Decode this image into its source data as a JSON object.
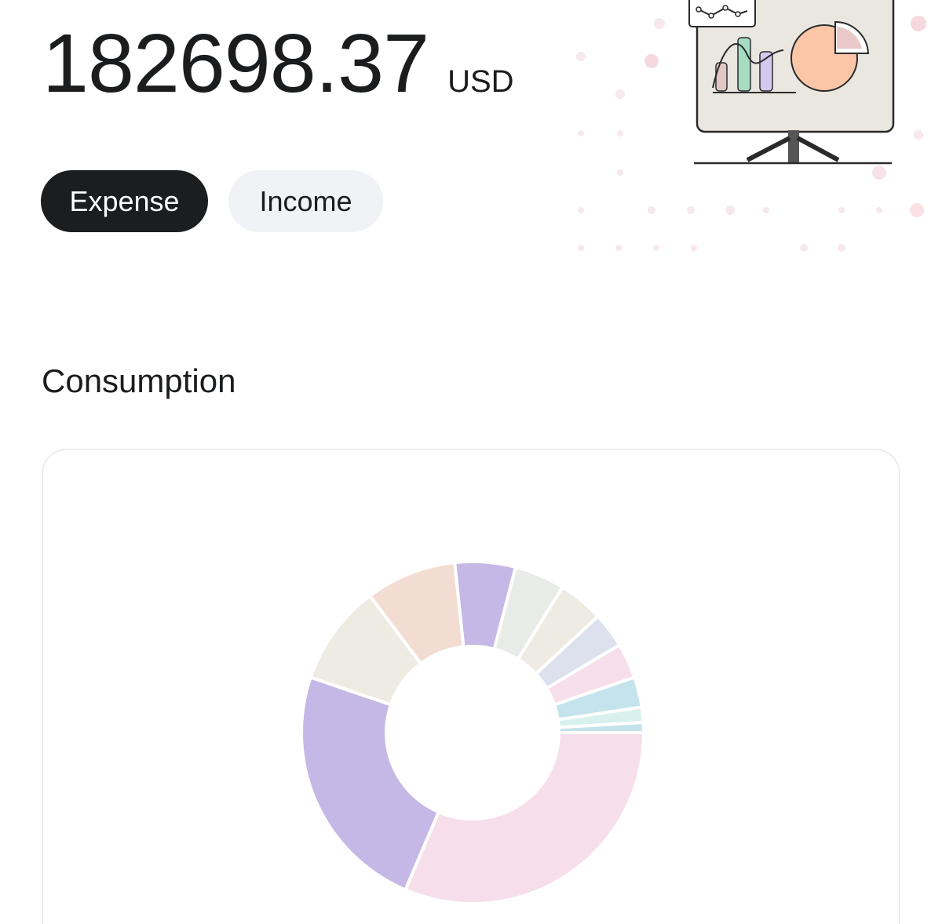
{
  "balance": {
    "amount": "182698.37",
    "currency": "USD"
  },
  "tabs": [
    {
      "label": "Expense",
      "selected": true
    },
    {
      "label": "Income",
      "selected": false
    }
  ],
  "illustration": {
    "icon": "presentation-board-chart-illustration"
  },
  "section": {
    "title": "Consumption"
  },
  "chart_data": {
    "type": "pie",
    "style": "donut",
    "title": "",
    "slices": [
      {
        "value": 33.0,
        "color": "#f6dfea"
      },
      {
        "value": 25.0,
        "color": "#c5b8e6"
      },
      {
        "value": 10.0,
        "color": "#eeebe3"
      },
      {
        "value": 9.0,
        "color": "#f3ddd3"
      },
      {
        "value": 6.0,
        "color": "#c5b8e6"
      },
      {
        "value": 5.0,
        "color": "#e8ebe7"
      },
      {
        "value": 4.5,
        "color": "#eeebe3"
      },
      {
        "value": 3.5,
        "color": "#dde1ee"
      },
      {
        "value": 3.5,
        "color": "#f6dfea"
      },
      {
        "value": 3.0,
        "color": "#c4e3ec"
      },
      {
        "value": 1.5,
        "color": "#d8f0ee"
      },
      {
        "value": 1.0,
        "color": "#c4e3ec"
      }
    ]
  }
}
